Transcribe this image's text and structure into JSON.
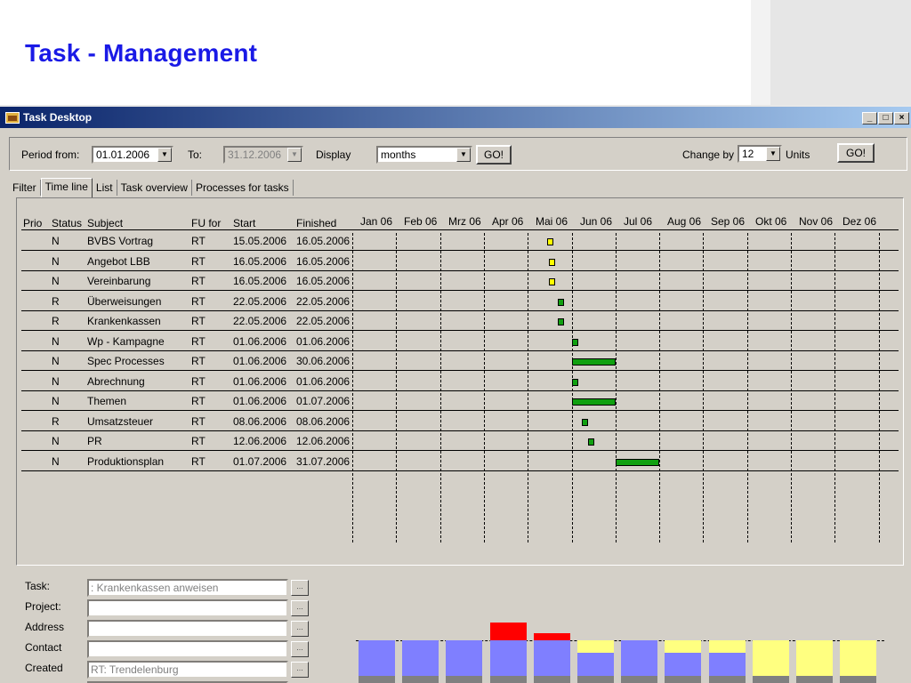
{
  "slide": {
    "title": "Task - Management"
  },
  "window": {
    "title": "Task Desktop",
    "buttons": [
      "_",
      "□",
      "×"
    ]
  },
  "toolbar": {
    "period_from_label": "Period from:",
    "period_from_value": "01.01.2006",
    "to_label": "To:",
    "to_value": "31.12.2006",
    "display_label": "Display",
    "display_value": "months",
    "go_label": "GO!",
    "change_by_label": "Change by",
    "change_by_value": "12",
    "units_label": "Units",
    "go2_label": "GO!"
  },
  "tabs": [
    "Filter",
    "Time line",
    "List",
    "Task overview",
    "Processes for tasks"
  ],
  "grid": {
    "headers": [
      "Prio",
      "Status",
      "Subject",
      "FU for",
      "Start",
      "Finished"
    ],
    "months": [
      "Jan 06",
      "Feb 06",
      "Mrz 06",
      "Apr 06",
      "Mai 06",
      "Jun 06",
      "Jul 06",
      "Aug 06",
      "Sep 06",
      "Okt 06",
      "Nov 06",
      "Dez 06"
    ],
    "rows": [
      {
        "prio": "",
        "status": "N",
        "subject": "BVBS Vortrag",
        "fu": "RT",
        "start": "15.05.2006",
        "finished": "16.05.2006",
        "bar": {
          "month": 4,
          "from": 0.45,
          "to": 0.52,
          "color": "#ffff00"
        }
      },
      {
        "prio": "",
        "status": "N",
        "subject": "Angebot LBB",
        "fu": "RT",
        "start": "16.05.2006",
        "finished": "16.05.2006",
        "bar": {
          "month": 4,
          "from": 0.48,
          "to": 0.52,
          "color": "#ffff00"
        }
      },
      {
        "prio": "",
        "status": "N",
        "subject": "Vereinbarung",
        "fu": "RT",
        "start": "16.05.2006",
        "finished": "16.05.2006",
        "bar": {
          "month": 4,
          "from": 0.48,
          "to": 0.52,
          "color": "#ffff00"
        }
      },
      {
        "prio": "",
        "status": "R",
        "subject": "Überweisungen",
        "fu": "RT",
        "start": "22.05.2006",
        "finished": "22.05.2006",
        "bar": {
          "month": 4,
          "from": 0.68,
          "to": 0.72,
          "color": "#10a010"
        }
      },
      {
        "prio": "",
        "status": "R",
        "subject": "Krankenkassen",
        "fu": "RT",
        "start": "22.05.2006",
        "finished": "22.05.2006",
        "bar": {
          "month": 4,
          "from": 0.68,
          "to": 0.72,
          "color": "#10a010"
        }
      },
      {
        "prio": "",
        "status": "N",
        "subject": "Wp - Kampagne",
        "fu": "RT",
        "start": "01.06.2006",
        "finished": "01.06.2006",
        "bar": {
          "month": 5,
          "from": 0.0,
          "to": 0.06,
          "color": "#10a010"
        }
      },
      {
        "prio": "",
        "status": "N",
        "subject": "Spec Processes",
        "fu": "RT",
        "start": "01.06.2006",
        "finished": "30.06.2006",
        "bar": {
          "month": 5,
          "from": 0.0,
          "to": 1.0,
          "color": "#10a010"
        }
      },
      {
        "prio": "",
        "status": "N",
        "subject": "Abrechnung",
        "fu": "RT",
        "start": "01.06.2006",
        "finished": "01.06.2006",
        "bar": {
          "month": 5,
          "from": 0.0,
          "to": 0.06,
          "color": "#10a010"
        }
      },
      {
        "prio": "",
        "status": "N",
        "subject": "Themen",
        "fu": "RT",
        "start": "01.06.2006",
        "finished": "01.07.2006",
        "bar": {
          "month": 5,
          "from": 0.0,
          "to": 1.0,
          "color": "#10a010"
        }
      },
      {
        "prio": "",
        "status": "R",
        "subject": "Umsatzsteuer",
        "fu": "RT",
        "start": "08.06.2006",
        "finished": "08.06.2006",
        "bar": {
          "month": 5,
          "from": 0.24,
          "to": 0.3,
          "color": "#10a010"
        }
      },
      {
        "prio": "",
        "status": "N",
        "subject": "PR",
        "fu": "RT",
        "start": "12.06.2006",
        "finished": "12.06.2006",
        "bar": {
          "month": 5,
          "from": 0.38,
          "to": 0.44,
          "color": "#10a010"
        }
      },
      {
        "prio": "",
        "status": "N",
        "subject": "Produktionsplan",
        "fu": "RT",
        "start": "01.07.2006",
        "finished": "31.07.2006",
        "bar": {
          "month": 6,
          "from": 0.0,
          "to": 1.0,
          "color": "#10a010"
        }
      }
    ]
  },
  "details": {
    "task_label": "Task:",
    "task_value": ": Krankenkassen anweisen",
    "project_label": "Project:",
    "project_value": "",
    "address_label": "Address",
    "address_value": "",
    "contact_label": "Contact",
    "contact_value": "",
    "created_label": "Created",
    "created_value": "RT: Trendelenburg",
    "dots": "..."
  },
  "workload": {
    "colors": {
      "gray": "#808080",
      "blue": "#7f7fff",
      "yellow": "#ffff80",
      "red": "#ff0000"
    },
    "columns": [
      {
        "gray": 1,
        "blue": 1,
        "yellow": 0,
        "red": 0
      },
      {
        "gray": 1,
        "blue": 1,
        "yellow": 0,
        "red": 0
      },
      {
        "gray": 1,
        "blue": 1,
        "yellow": 0,
        "red": 0
      },
      {
        "gray": 1,
        "blue": 1,
        "yellow": 0,
        "red": 0.5
      },
      {
        "gray": 1,
        "blue": 1,
        "yellow": 0,
        "red": 0.2
      },
      {
        "gray": 1,
        "blue": 0.65,
        "yellow": 0.35,
        "red": 0
      },
      {
        "gray": 1,
        "blue": 1,
        "yellow": 0,
        "red": 0
      },
      {
        "gray": 1,
        "blue": 0.65,
        "yellow": 0.35,
        "red": 0
      },
      {
        "gray": 1,
        "blue": 0.65,
        "yellow": 0.35,
        "red": 0
      },
      {
        "gray": 1,
        "blue": 0,
        "yellow": 1,
        "red": 0
      },
      {
        "gray": 1,
        "blue": 0,
        "yellow": 1,
        "red": 0
      },
      {
        "gray": 1,
        "blue": 0,
        "yellow": 1,
        "red": 0
      }
    ]
  }
}
